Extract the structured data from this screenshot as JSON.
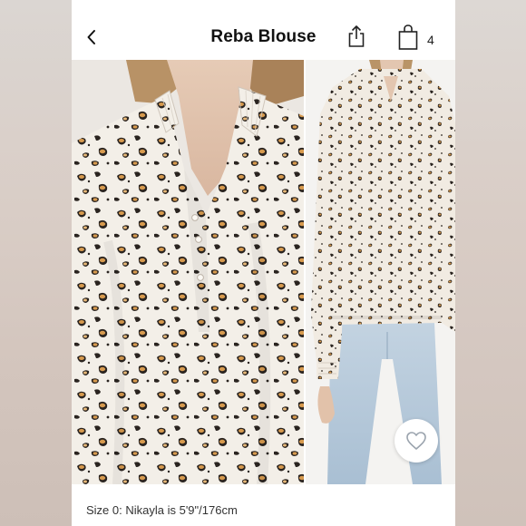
{
  "header": {
    "title": "Reba Blouse",
    "back_icon": "chevron-left-icon",
    "share_icon": "share-icon",
    "bag_icon": "shopping-bag-icon",
    "bag_count": "4"
  },
  "gallery": {
    "images": [
      {
        "name": "blouse-closeup-photo",
        "description_icon": "photo"
      },
      {
        "name": "model-full-photo",
        "description_icon": "photo"
      }
    ],
    "favorite_icon": "heart-icon"
  },
  "details": {
    "size_note": "Size 0: Nikayla is 5'9\"/176cm"
  },
  "colors": {
    "print_base": "#f3efe8",
    "spot_dark": "#2a2420",
    "spot_tan": "#d79a4e",
    "denim": "#b9cbdb"
  }
}
